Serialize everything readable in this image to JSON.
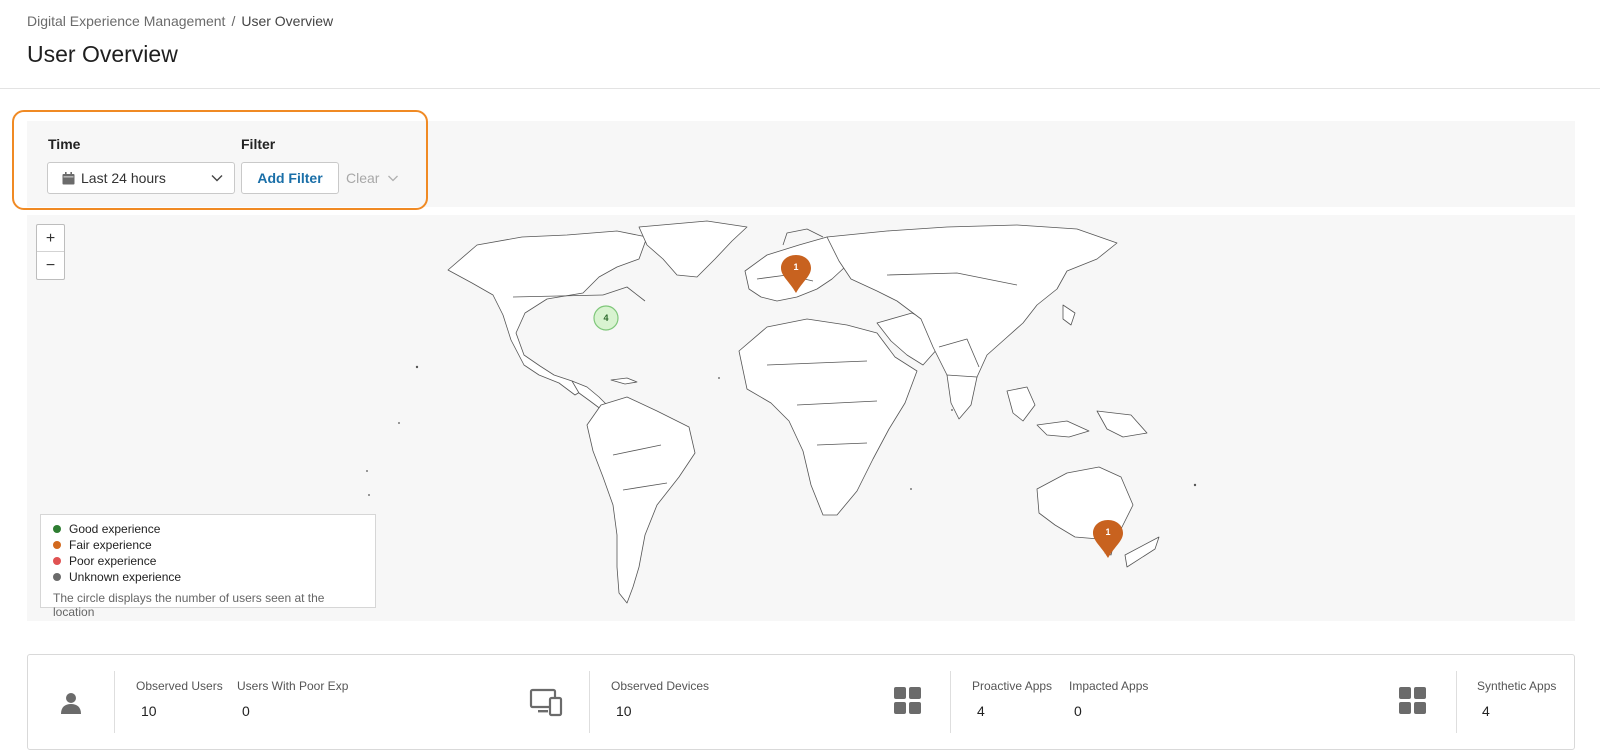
{
  "breadcrumb": {
    "parent": "Digital Experience Management",
    "separator": "/",
    "current": "User Overview"
  },
  "page_title": "User Overview",
  "filters": {
    "time_label": "Time",
    "time_value": "Last 24 hours",
    "filter_label": "Filter",
    "add_filter": "Add Filter",
    "clear": "Clear"
  },
  "map": {
    "zoom_in": "+",
    "zoom_out": "−",
    "markers": [
      {
        "kind": "pin",
        "count": "1",
        "experience": "fair",
        "region": "Western Europe"
      },
      {
        "kind": "cluster",
        "count": "4",
        "experience": "good",
        "region": "Eastern United States"
      },
      {
        "kind": "pin",
        "count": "1",
        "experience": "fair",
        "region": "Southeast Australia"
      }
    ]
  },
  "legend": {
    "items": [
      {
        "label": "Good experience",
        "color": "#2e7d32"
      },
      {
        "label": "Fair experience",
        "color": "#d2691e"
      },
      {
        "label": "Poor experience",
        "color": "#e05252"
      },
      {
        "label": "Unknown experience",
        "color": "#6b6b6b"
      }
    ],
    "note": "The circle displays the number of users seen at the location"
  },
  "stats": {
    "observed_users": {
      "label": "Observed Users",
      "value": "10"
    },
    "users_poor_exp": {
      "label": "Users With Poor Exp",
      "value": "0"
    },
    "observed_devices": {
      "label": "Observed Devices",
      "value": "10"
    },
    "proactive_apps": {
      "label": "Proactive Apps",
      "value": "4"
    },
    "impacted_apps": {
      "label": "Impacted Apps",
      "value": "0"
    },
    "synthetic_apps": {
      "label": "Synthetic Apps",
      "value": "4"
    }
  },
  "colors": {
    "accent_orange": "#f08a24",
    "link_blue": "#1a6fa8",
    "fair_marker": "#c8621f",
    "good_cluster_fill": "#d8f3d0"
  },
  "icons": [
    "calendar-icon",
    "chevron-down-icon",
    "user-icon",
    "devices-icon",
    "apps-grid-icon",
    "map-pin-icon"
  ]
}
